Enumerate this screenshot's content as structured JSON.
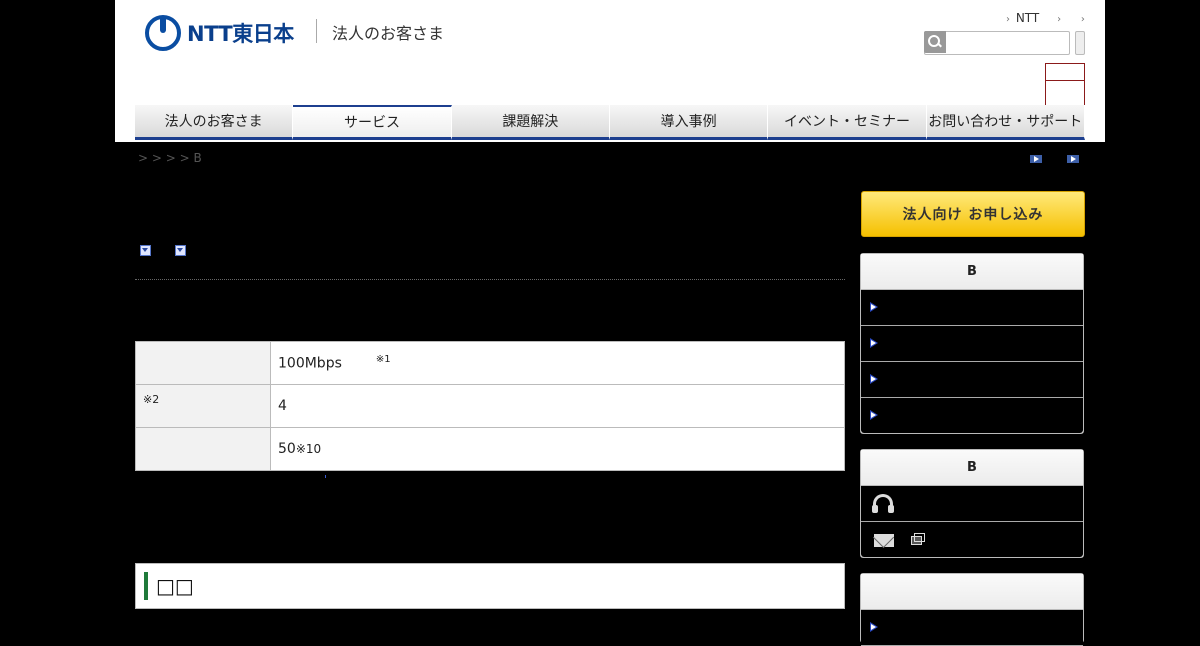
{
  "header": {
    "logo_text": "NTT東日本",
    "logo_subtitle": "法人のお客さま",
    "top_link": "NTT",
    "search": {
      "placeholder": ""
    }
  },
  "nav": {
    "items": [
      {
        "label": "法人のお客さま"
      },
      {
        "label": "サービス"
      },
      {
        "label": "課題解決"
      },
      {
        "label": "導入事例"
      },
      {
        "label": "イベント・セミナー"
      },
      {
        "label": "お問い合わせ・サポート"
      }
    ],
    "active_index": 1
  },
  "breadcrumb": "> > > > B",
  "spec_table": {
    "rows": [
      {
        "header": "",
        "value": "100Mbps",
        "note": "※1"
      },
      {
        "header": "※2",
        "value": "4",
        "note": ""
      },
      {
        "header": "",
        "value": "50",
        "note": "※10"
      }
    ]
  },
  "section_heading": "□□",
  "sidebar": {
    "apply_button": "法人向け お申し込み",
    "panel1": {
      "title": "B",
      "rows": 4
    },
    "panel2": {
      "title": "B"
    },
    "panel3": {
      "title": ""
    }
  },
  "colors": {
    "brand": "#0a4da2",
    "nav_border": "#1d3f8f",
    "accent_yellow": "#f5c000",
    "heading_bar": "#1f7a3a"
  }
}
